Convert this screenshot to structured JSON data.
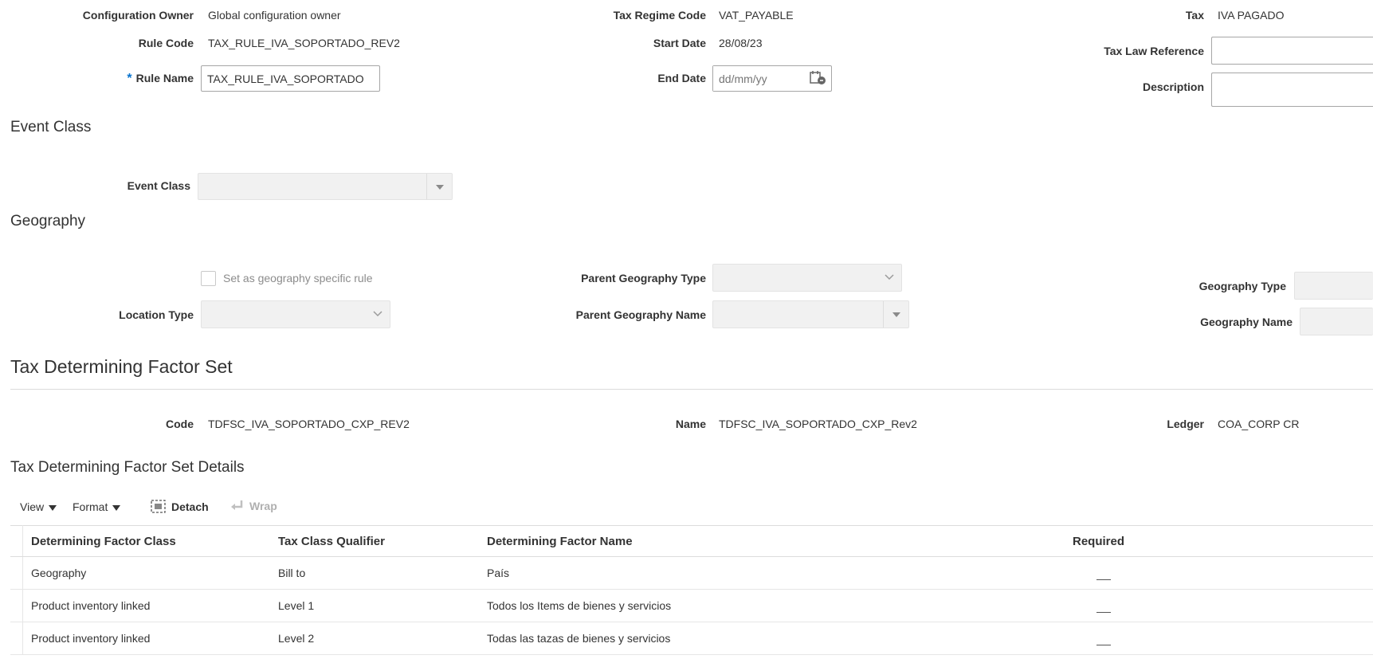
{
  "header": {
    "configuration_owner": {
      "label": "Configuration Owner",
      "value": "Global configuration owner"
    },
    "rule_code": {
      "label": "Rule Code",
      "value": "TAX_RULE_IVA_SOPORTADO_REV2"
    },
    "rule_name": {
      "required_mark": "*",
      "label": "Rule Name",
      "value": "TAX_RULE_IVA_SOPORTADO"
    },
    "tax_regime_code": {
      "label": "Tax Regime Code",
      "value": "VAT_PAYABLE"
    },
    "start_date": {
      "label": "Start Date",
      "value": "28/08/23"
    },
    "end_date": {
      "label": "End Date",
      "placeholder": "dd/mm/yy"
    },
    "tax": {
      "label": "Tax",
      "value": "IVA PAGADO"
    },
    "tax_law_reference": {
      "label": "Tax Law Reference",
      "value": ""
    },
    "description": {
      "label": "Description",
      "value": ""
    }
  },
  "event_class_section": {
    "title": "Event Class",
    "event_class": {
      "label": "Event Class",
      "value": ""
    }
  },
  "geography_section": {
    "title": "Geography",
    "geo_specific_checkbox": {
      "label": "Set as geography specific rule",
      "checked": false
    },
    "location_type": {
      "label": "Location Type",
      "value": ""
    },
    "parent_geography_type": {
      "label": "Parent Geography Type",
      "value": ""
    },
    "parent_geography_name": {
      "label": "Parent Geography Name",
      "value": ""
    },
    "geography_type": {
      "label": "Geography Type",
      "value": ""
    },
    "geography_name": {
      "label": "Geography Name",
      "value": ""
    }
  },
  "factor_set_section": {
    "title": "Tax Determining Factor Set",
    "code": {
      "label": "Code",
      "value": "TDFSC_IVA_SOPORTADO_CXP_REV2"
    },
    "name": {
      "label": "Name",
      "value": "TDFSC_IVA_SOPORTADO_CXP_Rev2"
    },
    "ledger": {
      "label": "Ledger",
      "value": "COA_CORP CR"
    }
  },
  "details_section": {
    "title": "Tax Determining Factor Set Details",
    "toolbar": {
      "view": "View",
      "format": "Format",
      "detach": "Detach",
      "wrap": "Wrap"
    },
    "columns": [
      "Determining Factor Class",
      "Tax Class Qualifier",
      "Determining Factor Name",
      "Required"
    ],
    "rows": [
      {
        "factor_class": "Geography",
        "qualifier": "Bill to",
        "factor_name": "País",
        "required": "—"
      },
      {
        "factor_class": "Product inventory linked",
        "qualifier": "Level 1",
        "factor_name": "Todos los Items de bienes y servicios",
        "required": "—"
      },
      {
        "factor_class": "Product inventory linked",
        "qualifier": "Level 2",
        "factor_name": "Todas las tazas de bienes y servicios",
        "required": "—"
      }
    ]
  },
  "colors": {
    "accent": "#0572ce",
    "disabled_field": "#f1f1f1",
    "text": "#333333"
  }
}
